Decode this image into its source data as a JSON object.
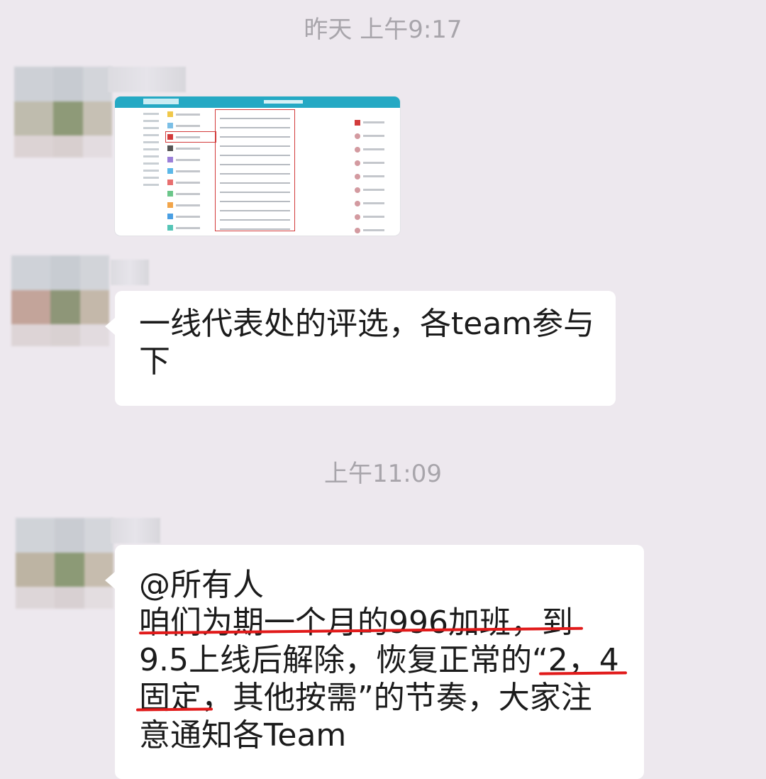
{
  "chat": {
    "timestamp_1": "昨天 上午9:17",
    "timestamp_2": "上午11:09",
    "messages": [
      {
        "type": "image",
        "content": "screenshot-thumbnail"
      },
      {
        "type": "text",
        "lines": [
          "一线代表处的评选，各team参与",
          "下"
        ]
      },
      {
        "type": "text",
        "lines": [
          "@所有人",
          "咱们为期一个月的996加班，到",
          "9.5上线后解除，恢复正常的“2，4",
          "固定，其他按需”的节奏，大家注",
          "意通知各Team"
        ]
      }
    ]
  },
  "colors": {
    "background": "#ede8ee",
    "bubble": "#ffffff",
    "timestamp": "#a8a5ab",
    "underline": "#e11a1a",
    "screenshot_header": "#25a9c4"
  }
}
